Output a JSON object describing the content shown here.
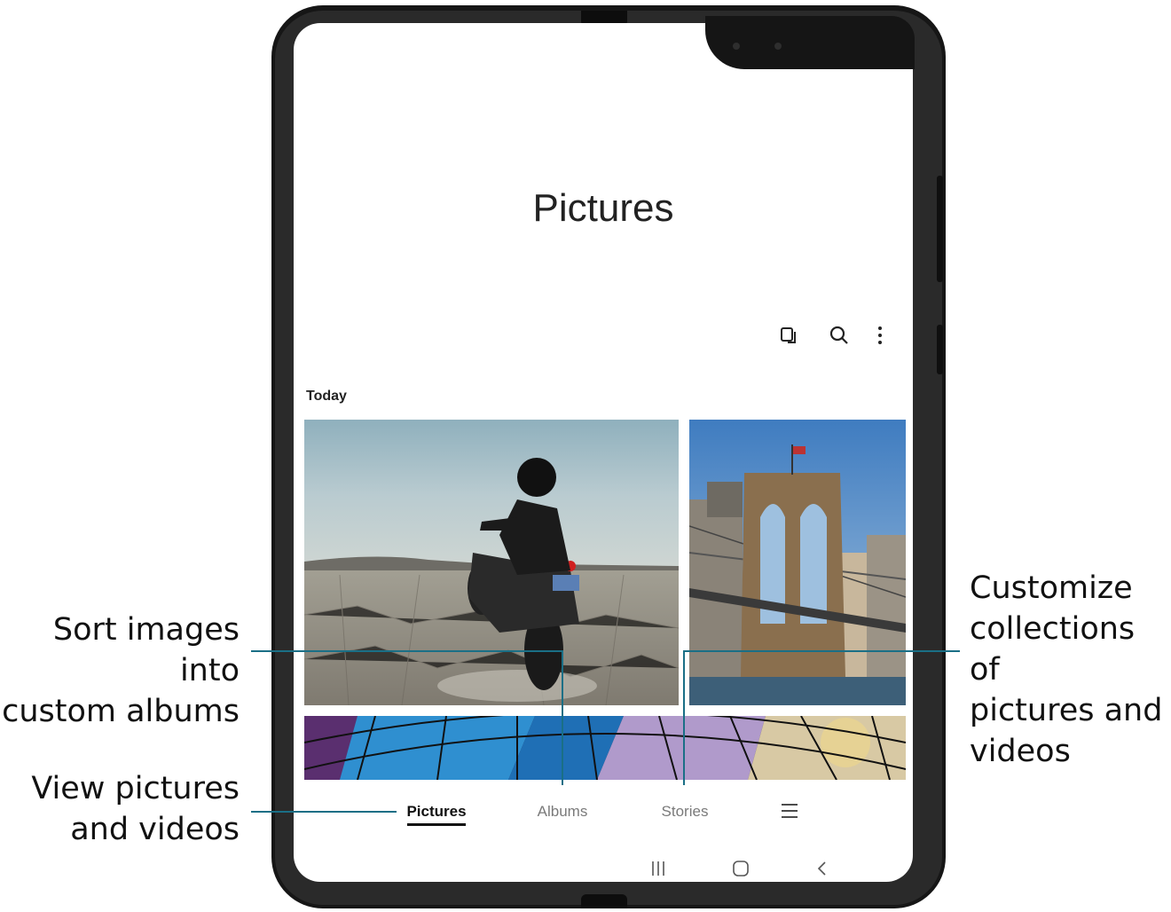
{
  "app": {
    "title": "Pictures",
    "section_label": "Today"
  },
  "toolbar": {
    "icons": [
      "select-icon",
      "search-icon",
      "more-options-icon"
    ]
  },
  "bottom_nav": {
    "tabs": [
      {
        "label": "Pictures",
        "active": true
      },
      {
        "label": "Albums",
        "active": false
      },
      {
        "label": "Stories",
        "active": false
      }
    ],
    "menu_icon": "hamburger-menu-icon"
  },
  "system_nav": [
    "recent-apps-icon",
    "home-icon",
    "back-icon"
  ],
  "callouts": {
    "sort_line1": "Sort images into",
    "sort_line2": "custom albums",
    "view_line1": "View pictures",
    "view_line2": "and videos",
    "custom_line1": "Customize",
    "custom_line2": "collections of",
    "custom_line3": "pictures and",
    "custom_line4": "videos"
  },
  "colors": {
    "callout_line": "#1a6f86",
    "device": "#161616"
  }
}
